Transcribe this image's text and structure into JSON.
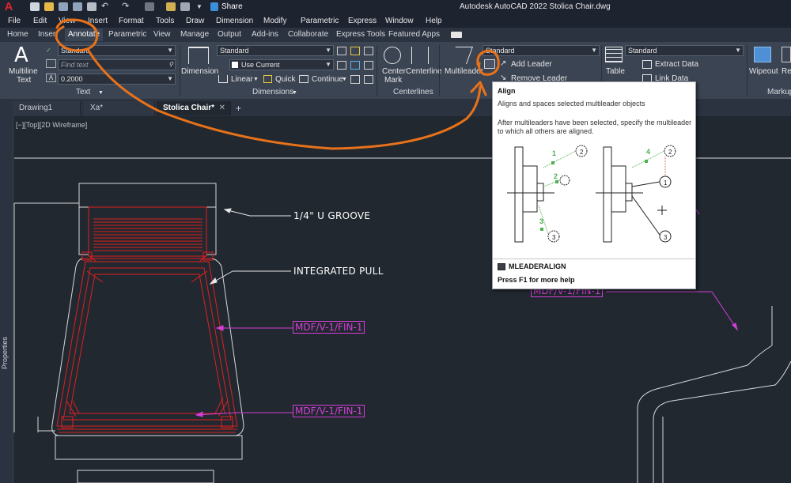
{
  "app": {
    "logo": "A",
    "window_title": "Autodesk AutoCAD 2022   Stolica Chair.dwg",
    "share_label": "Share"
  },
  "menu": [
    "File",
    "Edit",
    "View",
    "Insert",
    "Format",
    "Tools",
    "Draw",
    "Dimension",
    "Modify",
    "Parametric",
    "Express",
    "Window",
    "Help"
  ],
  "ribbon_tabs": [
    "Home",
    "Insert",
    "Annotate",
    "Parametric",
    "View",
    "Manage",
    "Output",
    "Add-ins",
    "Collaborate",
    "Express Tools",
    "Featured Apps"
  ],
  "active_ribbon_tab": "Annotate",
  "ribbon": {
    "text_panel": {
      "title": "Text",
      "multiline_label_1": "Multiline",
      "multiline_label_2": "Text",
      "style_value": "Standard",
      "find_placeholder": "Find text",
      "height_value": "0.2000"
    },
    "dimensions_panel": {
      "title": "Dimensions",
      "dimension_label": "Dimension",
      "dimstyle_value": "Standard",
      "layer_value": "Use Current",
      "linear_label": "Linear",
      "quick_label": "Quick",
      "continue_label": "Continue"
    },
    "centerlines_panel": {
      "title": "Centerlines",
      "center_mark_1": "Center",
      "center_mark_2": "Mark",
      "centerline_label": "Centerline"
    },
    "leaders_panel": {
      "multileader_label": "Multileader",
      "style_value": "Standard",
      "add_leader_label": "Add Leader",
      "remove_leader_label": "Remove Leader"
    },
    "tables_panel": {
      "table_label": "Table",
      "style_value": "Standard",
      "extract_data_label": "Extract Data",
      "link_data_label": "Link Data"
    },
    "markup_panel": {
      "title": "Markup",
      "wipeout_label": "Wipeout",
      "extra_label": "Re"
    }
  },
  "file_tabs": [
    {
      "label": "Drawing1",
      "active": false
    },
    {
      "label": "Xa*",
      "active": false
    },
    {
      "label": "Stolica Chair*",
      "active": true
    }
  ],
  "drawing": {
    "view_label": "[−][Top][2D Wireframe]",
    "properties_label": "Properties",
    "annotations": {
      "groove": "1/4\" U GROOVE",
      "pull": "INTEGRATED PULL",
      "tag1": "MDF/V-1/FIN-1",
      "tag2": "MDF/V-1/FIN-1",
      "tag3": "MDF/V-1/FIN-1"
    }
  },
  "tooltip": {
    "title": "Align",
    "description": "Aligns and spaces selected multileader objects",
    "detail": "After multileaders have been selected, specify the multileader to which all others are aligned.",
    "command": "MLEADERALIGN",
    "help": "Press F1 for more help",
    "diagram_numbers": [
      "1",
      "2",
      "3",
      "4"
    ]
  },
  "colors": {
    "background": "#212830",
    "ribbon": "#3b4453",
    "annotation_magenta": "#d43ed8",
    "geometry_red": "#e02020",
    "markup_orange": "#e8721a"
  }
}
